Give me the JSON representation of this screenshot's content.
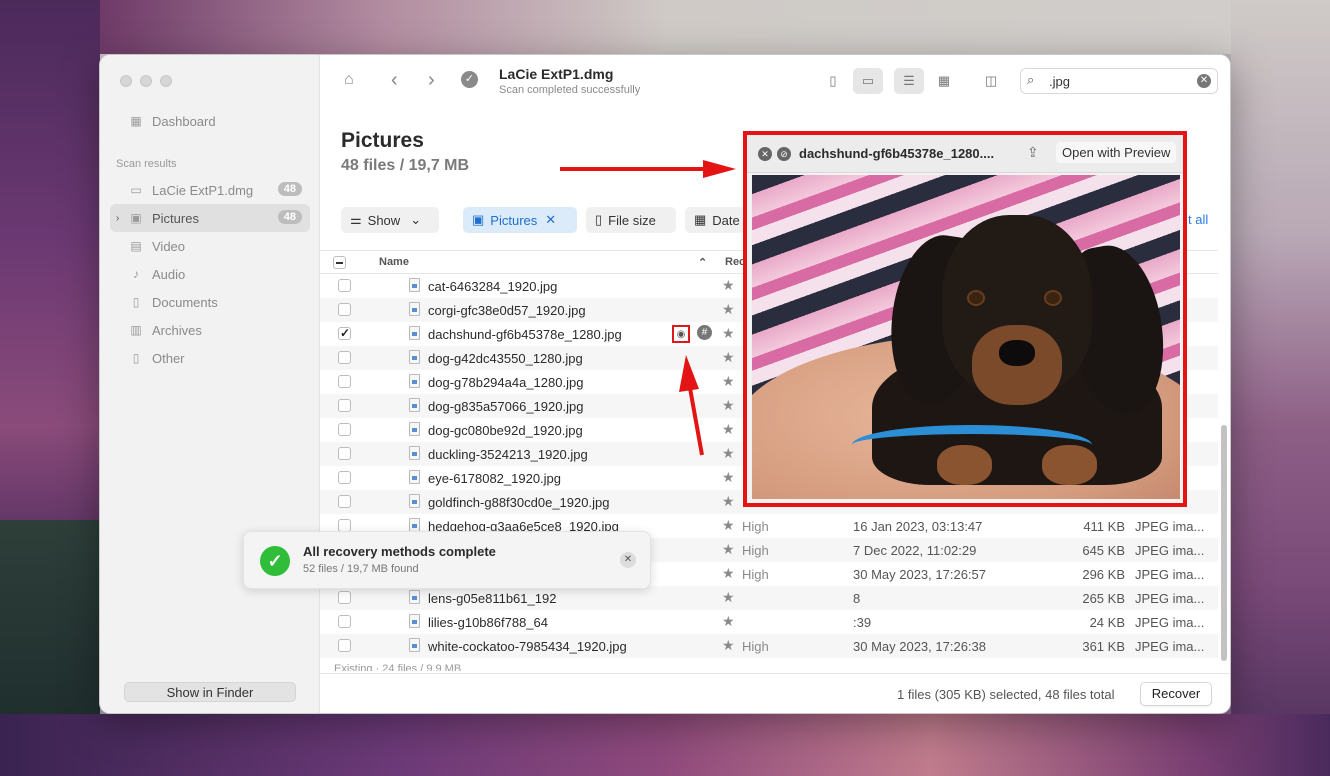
{
  "window": {
    "title": "LaCie ExtP1.dmg",
    "subtitle": "Scan completed successfully"
  },
  "sidebar": {
    "dashboard": "Dashboard",
    "section_label": "Scan results",
    "items": [
      {
        "label": "LaCie ExtP1.dmg",
        "count": "48",
        "icon": "drive-icon"
      },
      {
        "label": "Pictures",
        "count": "48",
        "icon": "image-icon"
      },
      {
        "label": "Video",
        "icon": "video-icon"
      },
      {
        "label": "Audio",
        "icon": "music-icon"
      },
      {
        "label": "Documents",
        "icon": "document-icon"
      },
      {
        "label": "Archives",
        "icon": "archive-icon"
      },
      {
        "label": "Other",
        "icon": "file-icon"
      }
    ],
    "show_in_finder": "Show in Finder"
  },
  "search": {
    "value": ".jpg"
  },
  "heading": {
    "title": "Pictures",
    "subtitle": "48 files / 19,7 MB"
  },
  "filters": {
    "show": "Show",
    "pictures": "Pictures",
    "file_size": "File size",
    "date": "Date",
    "select_all": "t all"
  },
  "table": {
    "col_name": "Name",
    "col_recovery": "Rec",
    "rows": [
      {
        "name": "cat-6463284_1920.jpg",
        "chance": "",
        "date": "",
        "size": "",
        "type": ""
      },
      {
        "name": "corgi-gfc38e0d57_1920.jpg",
        "chance": "",
        "date": "",
        "size": "",
        "type": ""
      },
      {
        "name": "dachshund-gf6b45378e_1280.jpg",
        "chance": "",
        "date": "",
        "size": "",
        "type": ""
      },
      {
        "name": "dog-g42dc43550_1280.jpg",
        "chance": "",
        "date": "",
        "size": "",
        "type": ""
      },
      {
        "name": "dog-g78b294a4a_1280.jpg",
        "chance": "",
        "date": "",
        "size": "",
        "type": ""
      },
      {
        "name": "dog-g835a57066_1920.jpg",
        "chance": "",
        "date": "",
        "size": "",
        "type": ""
      },
      {
        "name": "dog-gc080be92d_1920.jpg",
        "chance": "",
        "date": "",
        "size": "",
        "type": ""
      },
      {
        "name": "duckling-3524213_1920.jpg",
        "chance": "",
        "date": "",
        "size": "",
        "type": ""
      },
      {
        "name": "eye-6178082_1920.jpg",
        "chance": "",
        "date": "",
        "size": "",
        "type": ""
      },
      {
        "name": "goldfinch-g88f30cd0e_1920.jpg",
        "chance": "",
        "date": "",
        "size": "",
        "type": ""
      },
      {
        "name": "hedgehog-g3aa6e5ce8_1920.jpg",
        "chance": "High",
        "date": "16 Jan 2023, 03:13:47",
        "size": "411 KB",
        "type": "JPEG ima..."
      },
      {
        "name": "kittens-2273598_1920.jpg",
        "chance": "High",
        "date": "7 Dec 2022, 11:02:29",
        "size": "645 KB",
        "type": "JPEG ima..."
      },
      {
        "name": "kitty-2948404_1280.jpg",
        "chance": "High",
        "date": "30 May 2023, 17:26:57",
        "size": "296 KB",
        "type": "JPEG ima..."
      },
      {
        "name": "lens-g05e811b61_192",
        "chance": "",
        "date": "8",
        "size": "265 KB",
        "type": "JPEG ima..."
      },
      {
        "name": "lilies-g10b86f788_64",
        "chance": "",
        "date": ":39",
        "size": "24 KB",
        "type": "JPEG ima..."
      },
      {
        "name": "white-cockatoo-7985434_1920.jpg",
        "chance": "High",
        "date": "30 May 2023, 17:26:38",
        "size": "361 KB",
        "type": "JPEG ima..."
      }
    ],
    "existing": "Existing · 24 files / 9,9 MB"
  },
  "footer": {
    "status": "1 files (305 KB) selected, 48 files total",
    "recover": "Recover"
  },
  "toast": {
    "title": "All recovery methods complete",
    "detail": "52 files / 19,7 MB found"
  },
  "preview": {
    "filename": "dachshund-gf6b45378e_1280....",
    "open_with": "Open with Preview"
  },
  "colors": {
    "accent": "#2a7ae2",
    "highlight": "#e51414",
    "success": "#2fbd3a"
  }
}
